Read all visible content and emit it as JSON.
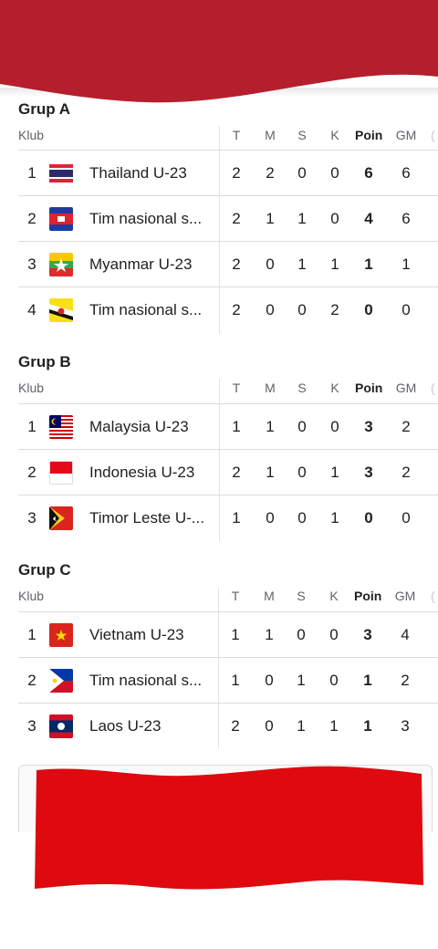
{
  "columns": {
    "klub": "Klub",
    "t": "T",
    "m": "M",
    "s": "S",
    "k": "K",
    "poin": "Poin",
    "gm": "GM",
    "cut": "("
  },
  "groups": [
    {
      "title": "Grup A",
      "rows": [
        {
          "rank": "1",
          "team": "Thailand U-23",
          "flag": "thailand-flag",
          "t": "2",
          "m": "2",
          "s": "0",
          "k": "0",
          "poin": "6",
          "gm": "6"
        },
        {
          "rank": "2",
          "team": "Tim nasional s...",
          "flag": "cambodia-flag",
          "t": "2",
          "m": "1",
          "s": "1",
          "k": "0",
          "poin": "4",
          "gm": "6"
        },
        {
          "rank": "3",
          "team": "Myanmar U-23",
          "flag": "myanmar-flag",
          "t": "2",
          "m": "0",
          "s": "1",
          "k": "1",
          "poin": "1",
          "gm": "1"
        },
        {
          "rank": "4",
          "team": "Tim nasional s...",
          "flag": "brunei-flag",
          "t": "2",
          "m": "0",
          "s": "0",
          "k": "2",
          "poin": "0",
          "gm": "0"
        }
      ]
    },
    {
      "title": "Grup B",
      "rows": [
        {
          "rank": "1",
          "team": "Malaysia U-23",
          "flag": "malaysia-flag",
          "t": "1",
          "m": "1",
          "s": "0",
          "k": "0",
          "poin": "3",
          "gm": "2"
        },
        {
          "rank": "2",
          "team": "Indonesia U-23",
          "flag": "indonesia-flag",
          "t": "2",
          "m": "1",
          "s": "0",
          "k": "1",
          "poin": "3",
          "gm": "2"
        },
        {
          "rank": "3",
          "team": "Timor Leste U-...",
          "flag": "timor-leste-flag",
          "t": "1",
          "m": "0",
          "s": "0",
          "k": "1",
          "poin": "0",
          "gm": "0"
        }
      ]
    },
    {
      "title": "Grup C",
      "rows": [
        {
          "rank": "1",
          "team": "Vietnam U-23",
          "flag": "vietnam-flag",
          "t": "1",
          "m": "1",
          "s": "0",
          "k": "0",
          "poin": "3",
          "gm": "4"
        },
        {
          "rank": "2",
          "team": "Tim nasional s...",
          "flag": "philippines-flag",
          "t": "1",
          "m": "0",
          "s": "1",
          "k": "0",
          "poin": "1",
          "gm": "2"
        },
        {
          "rank": "3",
          "team": "Laos U-23",
          "flag": "laos-flag",
          "t": "2",
          "m": "0",
          "s": "1",
          "k": "1",
          "poin": "1",
          "gm": "3"
        }
      ]
    }
  ],
  "colors": {
    "banner_red": "#b8202b",
    "bottom_red": "#de0a0f"
  }
}
